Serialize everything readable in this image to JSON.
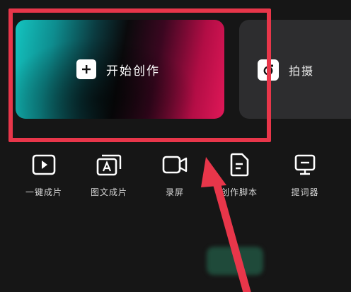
{
  "main": {
    "create_label": "开始创作",
    "shoot_label": "拍摄"
  },
  "tools": [
    {
      "label": "一键成片",
      "icon": "play-icon"
    },
    {
      "label": "图文成片",
      "icon": "text-image-icon"
    },
    {
      "label": "录屏",
      "icon": "video-camera-icon"
    },
    {
      "label": "创作脚本",
      "icon": "document-icon"
    },
    {
      "label": "提词器",
      "icon": "teleprompter-icon"
    }
  ],
  "colors": {
    "highlight": "#e8364a",
    "background": "#161616",
    "card_gradient_left": "#14c4c0",
    "card_gradient_right": "#e01858"
  }
}
